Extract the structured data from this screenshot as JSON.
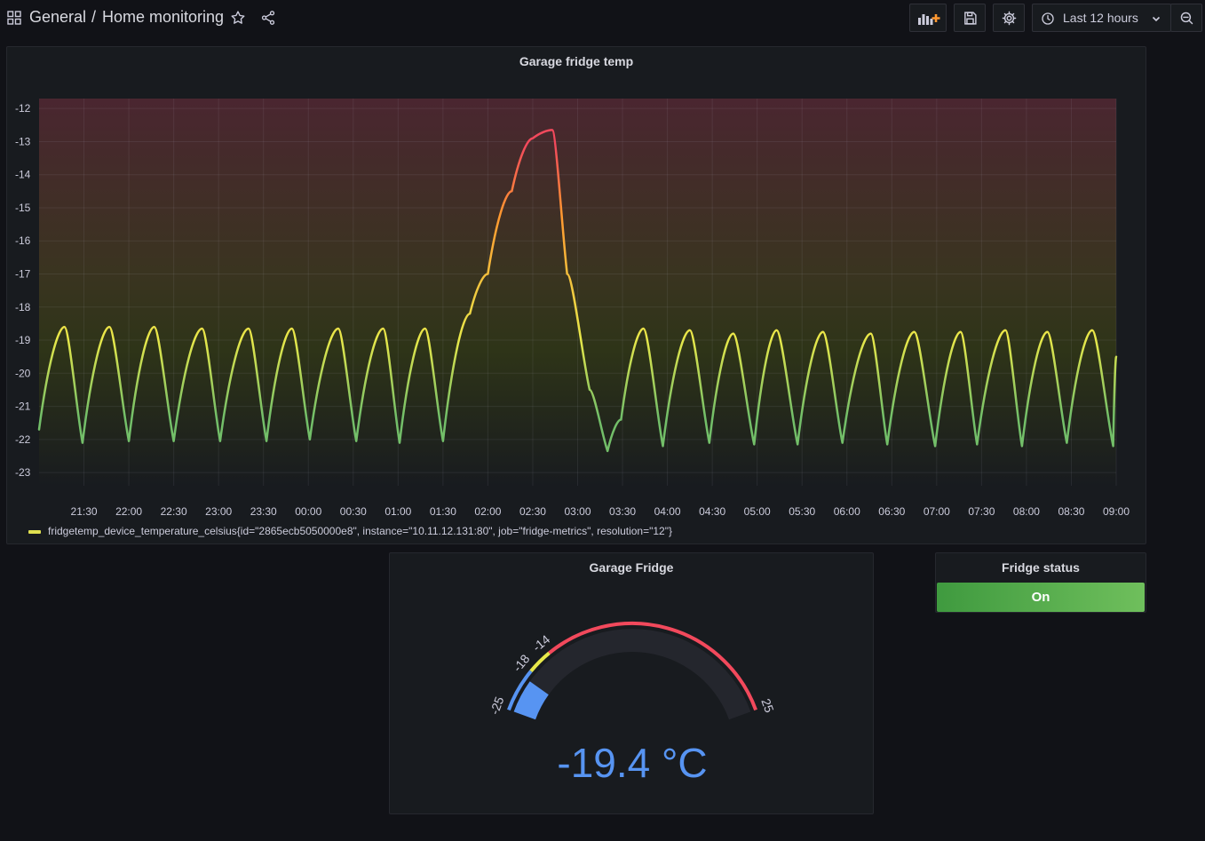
{
  "breadcrumb": {
    "folder": "General",
    "separator": "/",
    "title": "Home monitoring"
  },
  "toolbar": {
    "time_range": "Last 12 hours"
  },
  "colors": {
    "background": "#111217",
    "panel": "#181b1f",
    "line_green": "#73bf69",
    "line_yellow": "#e8e84a",
    "line_orange": "#ff9830",
    "line_red": "#f2495c",
    "gauge_blue": "#5794f2",
    "stat_green": "#56a64b"
  },
  "time_panel": {
    "title": "Garage fridge temp",
    "legend": "fridgetemp_device_temperature_celsius{id=\"2865ecb5050000e8\", instance=\"10.11.12.131:80\", job=\"fridge-metrics\", resolution=\"12\"}"
  },
  "chart_data": {
    "type": "line",
    "title": "Garage fridge temp",
    "xlabel": "",
    "ylabel": "",
    "ylim": [
      -23.4,
      -11.7
    ],
    "yticks": [
      "-12",
      "-13",
      "-14",
      "-15",
      "-16",
      "-17",
      "-18",
      "-19",
      "-20",
      "-21",
      "-22",
      "-23"
    ],
    "xticks": [
      "21:30",
      "22:00",
      "22:30",
      "23:00",
      "23:30",
      "00:00",
      "00:30",
      "01:00",
      "01:30",
      "02:00",
      "02:30",
      "03:00",
      "03:30",
      "04:00",
      "04:30",
      "05:00",
      "05:30",
      "06:00",
      "06:30",
      "07:00",
      "07:30",
      "08:00",
      "08:30",
      "09:00"
    ],
    "xlim": [
      "21:00",
      "09:00"
    ],
    "grid": true,
    "legend_placement": "bottom-left",
    "series": [
      {
        "name": "fridgetemp_device_temperature_celsius{id=\"2865ecb5050000e8\", instance=\"10.11.12.131:80\", job=\"fridge-metrics\", resolution=\"12\"}",
        "x": [
          "21:00",
          "21:17",
          "21:29",
          "21:47",
          "22:00",
          "22:17",
          "22:30",
          "22:49",
          "23:01",
          "23:20",
          "23:32",
          "23:49",
          "24:01",
          "24:20",
          "24:32",
          "24:50",
          "25:01",
          "25:18",
          "25:30",
          "25:48",
          "26:00",
          "26:16",
          "26:30",
          "26:43",
          "26:53",
          "27:08",
          "27:20",
          "27:29",
          "27:44",
          "27:57",
          "28:15",
          "28:28",
          "28:44",
          "28:58",
          "29:13",
          "29:27",
          "29:44",
          "29:57",
          "30:16",
          "30:27",
          "30:45",
          "30:59",
          "31:16",
          "31:27",
          "31:46",
          "31:57",
          "32:14",
          "32:27",
          "32:44",
          "32:58",
          "33:00"
        ],
        "y": [
          -21.7,
          -18.6,
          -22.1,
          -18.6,
          -22.05,
          -18.6,
          -22.05,
          -18.65,
          -22.05,
          -18.65,
          -22.05,
          -18.65,
          -22.0,
          -18.65,
          -22.05,
          -18.65,
          -22.1,
          -18.65,
          -22.05,
          -18.2,
          -17.0,
          -14.5,
          -12.9,
          -12.65,
          -17.0,
          -20.5,
          -22.35,
          -21.4,
          -18.65,
          -22.2,
          -18.7,
          -22.1,
          -18.8,
          -22.15,
          -18.7,
          -22.15,
          -18.75,
          -22.1,
          -18.8,
          -22.15,
          -18.75,
          -22.2,
          -18.75,
          -22.15,
          -18.7,
          -22.2,
          -18.75,
          -22.1,
          -18.7,
          -22.2,
          -19.5
        ]
      }
    ]
  },
  "gauge_panel": {
    "title": "Garage Fridge",
    "value_text": "-19.4 °C",
    "gauge_data": {
      "value": -19.4,
      "min": -25,
      "max": 25,
      "thresholds": [
        -18,
        -14
      ],
      "tick_labels": [
        "-25",
        "-18",
        "-14",
        "25"
      ]
    }
  },
  "stat_panel": {
    "title": "Fridge status",
    "value_text": "On"
  }
}
